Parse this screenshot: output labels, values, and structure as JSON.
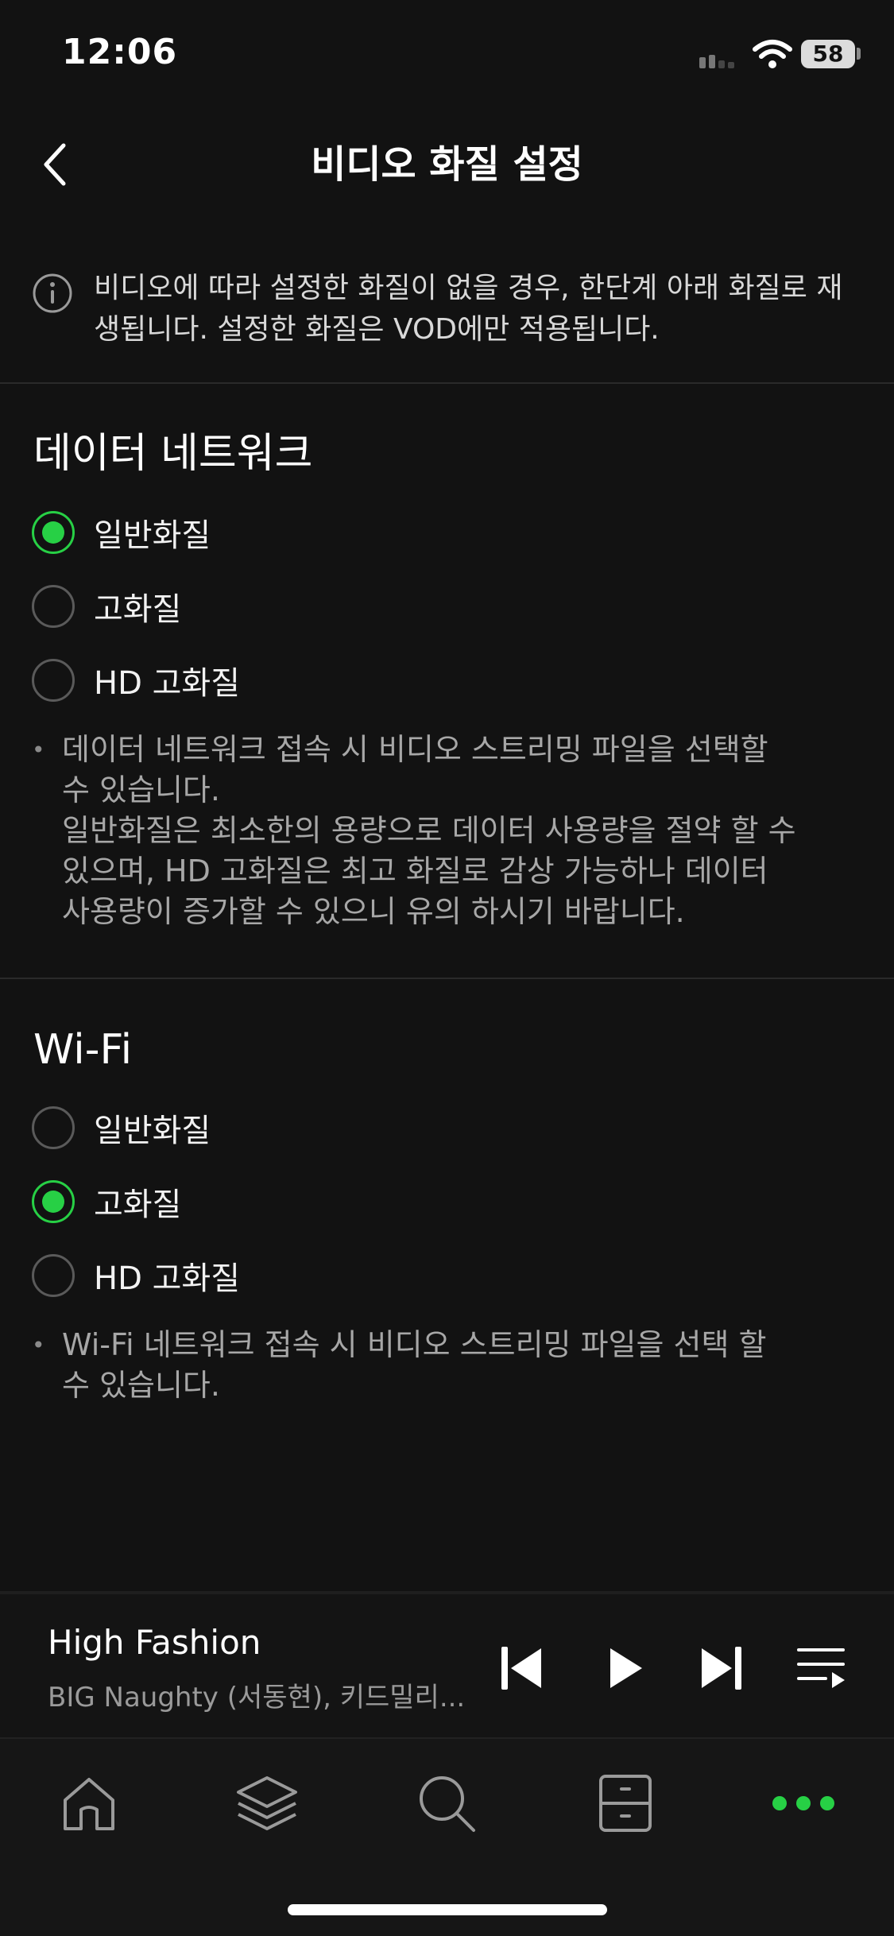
{
  "status_bar": {
    "time": "12:06",
    "battery": "58"
  },
  "header": {
    "title": "비디오 화질 설정"
  },
  "info": {
    "text": "비디오에 따라 설정한 화질이 없을 경우, 한단계 아래 화질로 재생됩니다. 설정한 화질은 VOD에만 적용됩니다."
  },
  "data_network": {
    "title": "데이터 네트워크",
    "options": [
      {
        "label": "일반화질",
        "selected": true
      },
      {
        "label": "고화질",
        "selected": false
      },
      {
        "label": "HD 고화질",
        "selected": false
      }
    ],
    "note": "데이터 네트워크 접속 시 비디오 스트리밍 파일을 선택할\n수 있습니다.\n일반화질은 최소한의 용량으로 데이터 사용량을 절약 할 수\n있으며, HD 고화질은 최고 화질로 감상 가능하나 데이터\n사용량이 증가할 수 있으니 유의 하시기 바랍니다."
  },
  "wifi": {
    "title": "Wi-Fi",
    "options": [
      {
        "label": "일반화질",
        "selected": false
      },
      {
        "label": "고화질",
        "selected": true
      },
      {
        "label": "HD 고화질",
        "selected": false
      }
    ],
    "note": "Wi-Fi 네트워크 접속 시 비디오 스트리밍 파일을 선택 할\n수 있습니다."
  },
  "player": {
    "track_title": "High Fashion",
    "track_artist": "BIG Naughty (서동현), 키드밀리..."
  },
  "tabs": [
    "home-icon",
    "layers-icon",
    "search-icon",
    "library-icon",
    "more-icon"
  ],
  "colors": {
    "accent": "#27d045",
    "background": "#121212"
  }
}
